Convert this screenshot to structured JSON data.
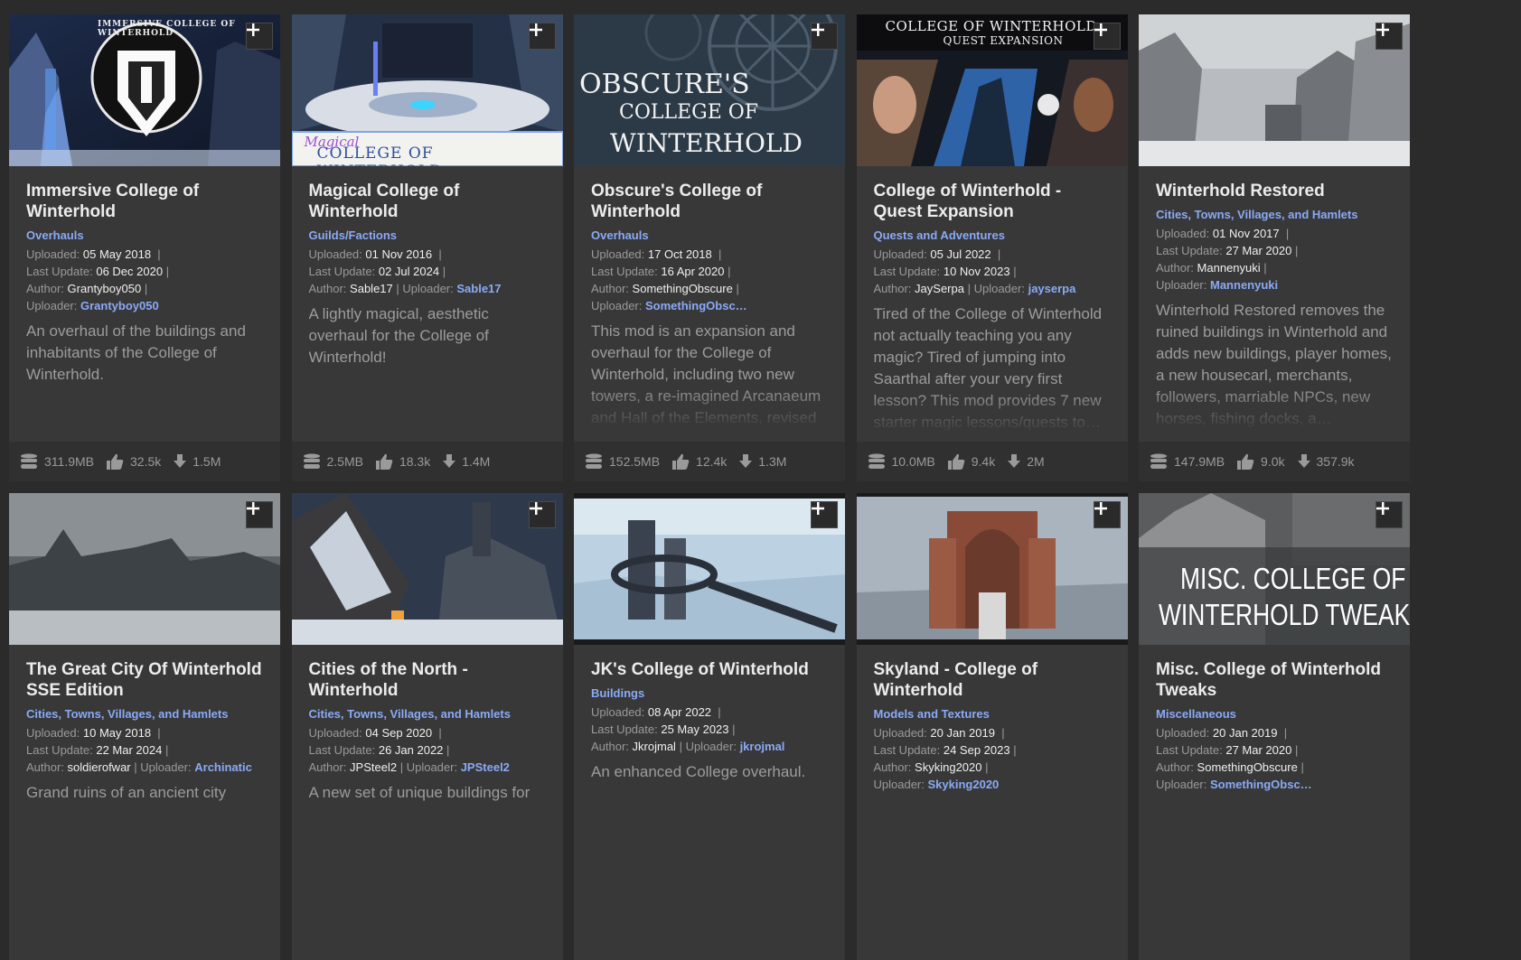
{
  "labels": {
    "uploaded": "Uploaded:",
    "last_update": "Last Update:",
    "author": "Author:",
    "uploader": "Uploader:"
  },
  "cards": [
    {
      "title": "Immersive College of Winterhold",
      "category": "Overhauls",
      "uploaded": "05 May 2018",
      "last_update": "06 Dec 2020",
      "author": "Grantyboy050",
      "uploader": "Grantyboy050",
      "description": "An overhaul of the buildings and inhabitants of the College of Winterhold.",
      "size": "311.9MB",
      "endorsements": "32.5k",
      "downloads": "1.5M",
      "image_text": "IMMERSIVE COLLEGE OF WINTERHOLD"
    },
    {
      "title": "Magical College of Winterhold",
      "category": "Guilds/Factions",
      "uploaded": "01 Nov 2016",
      "last_update": "02 Jul 2024",
      "author": "Sable17",
      "uploader": "Sable17",
      "description": "A lightly magical, aesthetic overhaul for the College of Winterhold!",
      "size": "2.5MB",
      "endorsements": "18.3k",
      "downloads": "1.4M",
      "image_text_1": "Magical",
      "image_text_2": "COLLEGE OF WINTERHOLD"
    },
    {
      "title": "Obscure's College of Winterhold",
      "category": "Overhauls",
      "uploaded": "17 Oct 2018",
      "last_update": "16 Apr 2020",
      "author": "SomethingObscure",
      "uploader": "SomethingObsc…",
      "description": "This mod is an expansion and overhaul for the College of Winterhold, including two new towers, a re-imagined Arcanaeum and Hall of the Elements, revised set dressing and clutter in many",
      "size": "152.5MB",
      "endorsements": "12.4k",
      "downloads": "1.3M",
      "image_text_1": "OBSCURE'S",
      "image_text_2": "COLLEGE OF",
      "image_text_3": "WINTERHOLD"
    },
    {
      "title": "College of Winterhold - Quest Expansion",
      "category": "Quests and Adventures",
      "uploaded": "05 Jul 2022",
      "last_update": "10 Nov 2023",
      "author": "JaySerpa",
      "uploader": "jayserpa",
      "description": "Tired of the College of Winterhold not actually teaching you any magic? Tired of jumping into Saarthal after your very first lesson? This mod provides 7 new starter magic lessons/quests to…",
      "size": "10.0MB",
      "endorsements": "9.4k",
      "downloads": "2M",
      "image_text_1": "COLLEGE OF WINTERHOLD",
      "image_text_2": "QUEST EXPANSION"
    },
    {
      "title": "Winterhold Restored",
      "category": "Cities, Towns, Villages, and Hamlets",
      "uploaded": "01 Nov 2017",
      "last_update": "27 Mar 2020",
      "author": "Mannenyuki",
      "uploader": "Mannenyuki",
      "description": "Winterhold Restored removes the ruined buildings in Winterhold and adds new buildings, player homes, a new housecarl, merchants, followers, marriable NPCs, new horses, fishing docks, a…",
      "size": "147.9MB",
      "endorsements": "9.0k",
      "downloads": "357.9k"
    },
    {
      "title": "The Great City Of Winterhold SSE Edition",
      "category": "Cities, Towns, Villages, and Hamlets",
      "uploaded": "10 May 2018",
      "last_update": "22 Mar 2024",
      "author": "soldierofwar",
      "uploader": "Archinatic",
      "description": "Grand ruins of an ancient city"
    },
    {
      "title": "Cities of the North - Winterhold",
      "category": "Cities, Towns, Villages, and Hamlets",
      "uploaded": "04 Sep 2020",
      "last_update": "26 Jan 2022",
      "author": "JPSteel2",
      "uploader": "JPSteel2",
      "description": "A new set of unique buildings for"
    },
    {
      "title": "JK's College of Winterhold",
      "category": "Buildings",
      "uploaded": "08 Apr 2022",
      "last_update": "25 May 2023",
      "author": "Jkrojmal",
      "uploader": "jkrojmal",
      "description": "An enhanced College overhaul."
    },
    {
      "title": "Skyland - College of Winterhold",
      "category": "Models and Textures",
      "uploaded": "20 Jan 2019",
      "last_update": "24 Sep 2023",
      "author": "Skyking2020",
      "uploader": "Skyking2020",
      "description": ""
    },
    {
      "title": "Misc. College of Winterhold Tweaks",
      "category": "Miscellaneous",
      "uploaded": "20 Jan 2019",
      "last_update": "27 Mar 2020",
      "author": "SomethingObscure",
      "uploader": "SomethingObsc…",
      "description": "",
      "image_text_1": "MISC. COLLEGE OF",
      "image_text_2": "WINTERHOLD TWEAKS"
    }
  ]
}
